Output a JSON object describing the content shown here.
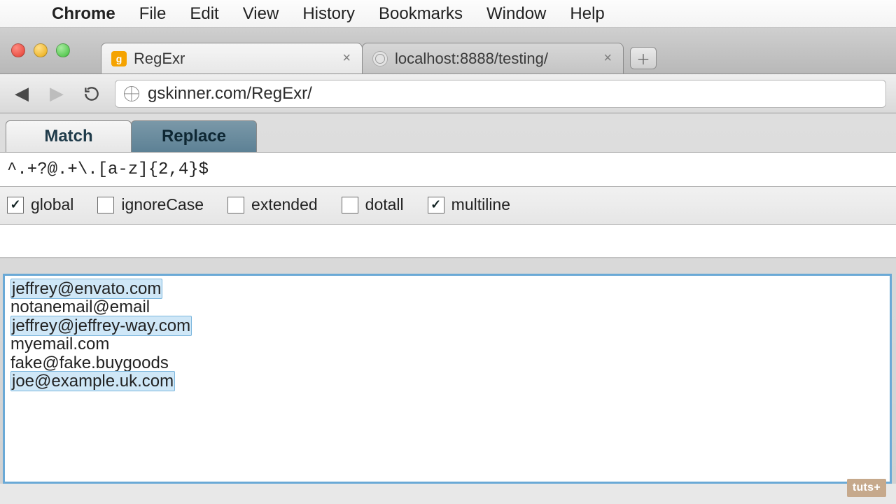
{
  "menubar": {
    "app_name": "Chrome",
    "items": [
      "File",
      "Edit",
      "View",
      "History",
      "Bookmarks",
      "Window",
      "Help"
    ]
  },
  "browser": {
    "tabs": [
      {
        "title": "RegExr",
        "active": true
      },
      {
        "title": "localhost:8888/testing/",
        "active": false
      }
    ],
    "url": "gskinner.com/RegExr/"
  },
  "regexr": {
    "modes": {
      "match": "Match",
      "replace": "Replace",
      "active": "replace"
    },
    "pattern": "^.+?@.+\\.[a-z]{2,4}$",
    "flags": {
      "global": {
        "label": "global",
        "checked": true
      },
      "ignoreCase": {
        "label": "ignoreCase",
        "checked": false
      },
      "extended": {
        "label": "extended",
        "checked": false
      },
      "dotall": {
        "label": "dotall",
        "checked": false
      },
      "multiline": {
        "label": "multiline",
        "checked": true
      }
    },
    "replace_with": "",
    "test_lines": [
      {
        "text": "jeffrey@envato.com",
        "match": true
      },
      {
        "text": "notanemail@email",
        "match": false
      },
      {
        "text": "jeffrey@jeffrey-way.com",
        "match": true
      },
      {
        "text": "myemail.com",
        "match": false
      },
      {
        "text": "fake@fake.buygoods",
        "match": false
      },
      {
        "text": "joe@example.uk.com",
        "match": true
      }
    ]
  },
  "watermark": "tuts+"
}
